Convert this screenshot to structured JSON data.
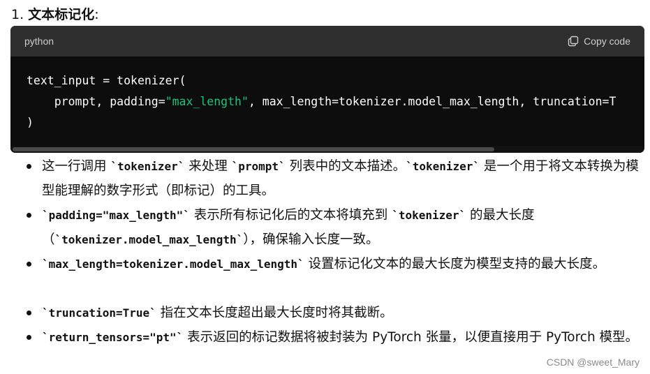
{
  "heading": {
    "number": "1.",
    "title": "文本标记化",
    "suffix": ":"
  },
  "code_block": {
    "language": "python",
    "copy_label": "Copy code",
    "lines": [
      [
        {
          "t": "text_input = tokenizer("
        }
      ],
      [
        {
          "t": "    prompt, padding="
        },
        {
          "t": "\"max_length\"",
          "s": "str"
        },
        {
          "t": ", max_length=tokenizer.model_max_length, truncation=T"
        }
      ],
      [
        {
          "t": ")"
        }
      ]
    ],
    "string_color": "#19c37d"
  },
  "bullets": [
    [
      {
        "t": "这一行调用 "
      },
      {
        "c": "`tokenizer`"
      },
      {
        "t": " 来处理 "
      },
      {
        "c": "`prompt`"
      },
      {
        "t": " 列表中的文本描述。"
      },
      {
        "c": "`tokenizer`"
      },
      {
        "t": " 是一个用于将文本转换为模型能理解的数字形式（即标记）的工具。"
      }
    ],
    [
      {
        "c": "`padding=\"max_length\"`"
      },
      {
        "t": " 表示所有标记化后的文本将填充到 "
      },
      {
        "c": "`tokenizer`"
      },
      {
        "t": " 的最大长度（"
      },
      {
        "c": "`tokenizer.model_max_length`"
      },
      {
        "t": "），确保输入长度一致。"
      }
    ],
    [
      {
        "c": "`max_length=tokenizer.model_max_length`"
      },
      {
        "t": " 设置标记化文本的最大长度为模型支持的最大长度。"
      }
    ],
    [
      {
        "c": "`truncation=True`"
      },
      {
        "t": " 指在文本长度超出最大长度时将其截断。"
      }
    ],
    [
      {
        "c": "`return_tensors=\"pt\"`"
      },
      {
        "t": " 表示返回的标记数据将被封装为 PyTorch 张量，以便直接用于 PyTorch 模型。"
      }
    ]
  ],
  "watermark": "CSDN @sweet_Mary"
}
